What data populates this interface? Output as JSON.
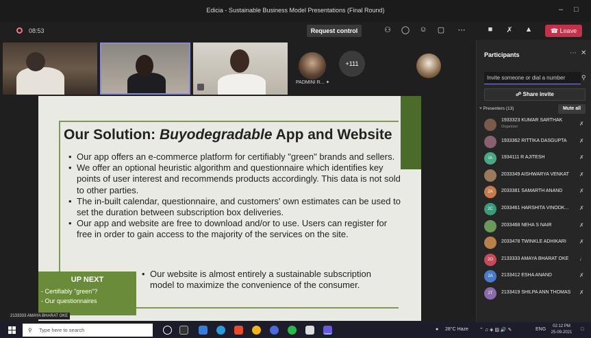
{
  "window": {
    "title": "Edicia - Sustainable Business Model Presentations (Final Round)"
  },
  "toolbar": {
    "recording_time": "08:53",
    "request_control_label": "Request control",
    "leave_label": "Leave",
    "icons": [
      "participants-icon",
      "chat-icon",
      "reactions-icon",
      "rooms-icon",
      "more-icon",
      "camera-off-icon",
      "mic-off-icon",
      "share-icon"
    ]
  },
  "gallery": {
    "more_count": "+111",
    "padmini_label": "PADMINI R..."
  },
  "slide": {
    "title_prefix": "Our Solution: ",
    "title_italic": "Buyodegradable",
    "title_suffix": " App and Website",
    "bullets": [
      "Our app offers an e-commerce platform for certifiably \"green\" brands and sellers.",
      "We offer an optional heuristic algorithm and questionnaire which identifies key points of user interest and recommends products accordingly. This data is not sold to other parties.",
      "The in-built calendar, questionnaire, and customers' own estimates can be used to set the duration between subscription box deliveries.",
      "Our app and website are free to download and/or to use. Users can register for free in order to gain access to the majority of the services on the site."
    ],
    "last_bullet": "Our website is almost entirely a sustainable subscription model to maximize the convenience of the consumer.",
    "upnext": {
      "heading": "UP NEXT",
      "line1": "- Certifiably \"green\"?",
      "line2": "- Our questionnaires"
    },
    "speaker_tag": "2133333 AMAYA BHARAT OKE",
    "accent_green": "#6a8c3a"
  },
  "participants": {
    "title": "Participants",
    "invite_placeholder": "Invite someone or dial a number",
    "share_invite_label": "Share invite",
    "presenters_label": "Presenters (13)",
    "mute_all_label": "Mute all",
    "list": [
      {
        "name": "1933323 KUMAR SARTHAK",
        "role": "Organizer",
        "avatar_color": "#7a5a4a",
        "initials": ""
      },
      {
        "name": "1933362 RITTIKA DASGUPTA",
        "role": "",
        "avatar_color": "#8a6070",
        "initials": ""
      },
      {
        "name": "1934111 R AJITESH",
        "role": "",
        "avatar_color": "#4aa886",
        "initials": "IA"
      },
      {
        "name": "2033349 AISHWARYA VENKAT",
        "role": "",
        "avatar_color": "#9a7a5a",
        "initials": ""
      },
      {
        "name": "2033381 SAMARTH ANAND",
        "role": "",
        "avatar_color": "#c87a4a",
        "initials": "2A"
      },
      {
        "name": "2033461 HARSHITA VINODK...",
        "role": "",
        "avatar_color": "#3a9a7a",
        "initials": "2C"
      },
      {
        "name": "2033468 NEHA S NAIR",
        "role": "",
        "avatar_color": "#6a9a5a",
        "initials": ""
      },
      {
        "name": "2033478 TWINKLE ADHIKARI",
        "role": "",
        "avatar_color": "#b8804a",
        "initials": ""
      },
      {
        "name": "2133333 AMAYA BHARAT OKE",
        "role": "",
        "avatar_color": "#c84a5a",
        "initials": "2O"
      },
      {
        "name": "2133412 ESHA ANAND",
        "role": "",
        "avatar_color": "#4a7ac8",
        "initials": "2A"
      },
      {
        "name": "2133419 SHILPA ANN THOMAS",
        "role": "",
        "avatar_color": "#8a6aa8",
        "initials": "2T"
      }
    ]
  },
  "taskbar": {
    "search_placeholder": "Type here to search",
    "weather": "28°C Haze",
    "lang": "ENG",
    "time": "02:12 PM",
    "date": "25-09-2021"
  }
}
